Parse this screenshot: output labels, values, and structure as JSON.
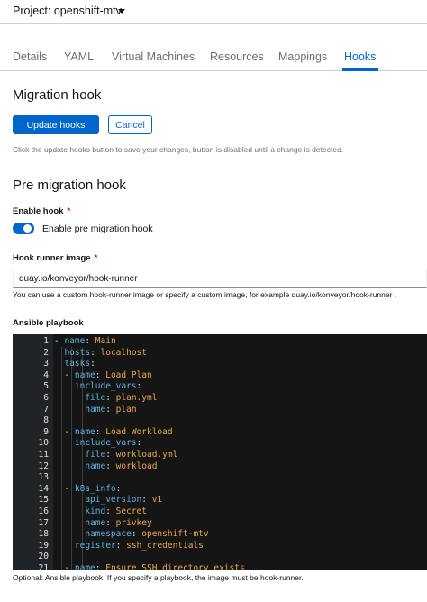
{
  "project": {
    "label": "Project: openshift-mtv"
  },
  "tabs": [
    {
      "label": "Details"
    },
    {
      "label": "YAML"
    },
    {
      "label": "Virtual Machines"
    },
    {
      "label": "Resources"
    },
    {
      "label": "Mappings"
    },
    {
      "label": "Hooks",
      "active": true
    }
  ],
  "migration_hook": {
    "title": "Migration hook",
    "update_label": "Update hooks",
    "cancel_label": "Cancel",
    "helper": "Click the update hooks button to save your changes, button is disabled until a change is detected."
  },
  "pre_migration": {
    "title": "Pre migration hook",
    "enable_label": "Enable hook",
    "enable_required": "*",
    "switch_label": "Enable pre migration hook",
    "switch_on": true,
    "image_label": "Hook runner image",
    "image_required": "*",
    "image_value": "quay.io/konveyor/hook-runner",
    "image_helper": "You can use a custom hook-runner image or specify a custom image, for example quay.io/konveyor/hook-runner .",
    "playbook_label": "Ansible playbook",
    "playbook_footer": "Optional: Ansible playbook. If you specify a playbook, the image must be hook-runner."
  },
  "playbook_lines": [
    {
      "n": "1",
      "indent": 0,
      "dash": true,
      "key": "name",
      "value": "Main"
    },
    {
      "n": "2",
      "indent": 1,
      "dash": false,
      "key": "hosts",
      "value": "localhost"
    },
    {
      "n": "3",
      "indent": 1,
      "dash": false,
      "key": "tasks",
      "value": ""
    },
    {
      "n": "4",
      "indent": 1,
      "dash": true,
      "key": "name",
      "value": "Load Plan"
    },
    {
      "n": "5",
      "indent": 2,
      "dash": false,
      "key": "include_vars",
      "value": ""
    },
    {
      "n": "6",
      "indent": 3,
      "dash": false,
      "key": "file",
      "value": "plan.yml"
    },
    {
      "n": "7",
      "indent": 3,
      "dash": false,
      "key": "name",
      "value": "plan"
    },
    {
      "n": "8",
      "indent": 0,
      "dash": false,
      "key": "",
      "value": ""
    },
    {
      "n": "9",
      "indent": 1,
      "dash": true,
      "key": "name",
      "value": "Load Workload"
    },
    {
      "n": "10",
      "indent": 2,
      "dash": false,
      "key": "include_vars",
      "value": ""
    },
    {
      "n": "11",
      "indent": 3,
      "dash": false,
      "key": "file",
      "value": "workload.yml"
    },
    {
      "n": "12",
      "indent": 3,
      "dash": false,
      "key": "name",
      "value": "workload"
    },
    {
      "n": "13",
      "indent": 0,
      "dash": false,
      "key": "",
      "value": ""
    },
    {
      "n": "14",
      "indent": 1,
      "dash": true,
      "key": "k8s_info",
      "value": ""
    },
    {
      "n": "15",
      "indent": 3,
      "dash": false,
      "key": "api_version",
      "value": "v1"
    },
    {
      "n": "16",
      "indent": 3,
      "dash": false,
      "key": "kind",
      "value": "Secret"
    },
    {
      "n": "17",
      "indent": 3,
      "dash": false,
      "key": "name",
      "value": "privkey"
    },
    {
      "n": "18",
      "indent": 3,
      "dash": false,
      "key": "namespace",
      "value": "openshift-mtv"
    },
    {
      "n": "19",
      "indent": 2,
      "dash": false,
      "key": "register",
      "value": "ssh_credentials"
    },
    {
      "n": "20",
      "indent": 0,
      "dash": false,
      "key": "",
      "value": ""
    },
    {
      "n": "21",
      "indent": 1,
      "dash": true,
      "key": "name",
      "value": "Ensure SSH directory exists"
    }
  ],
  "colors": {
    "primary": "#0066cc",
    "code_key": "#5fb0e6",
    "code_value": "#e8a84a",
    "editor_bg": "#151515"
  }
}
